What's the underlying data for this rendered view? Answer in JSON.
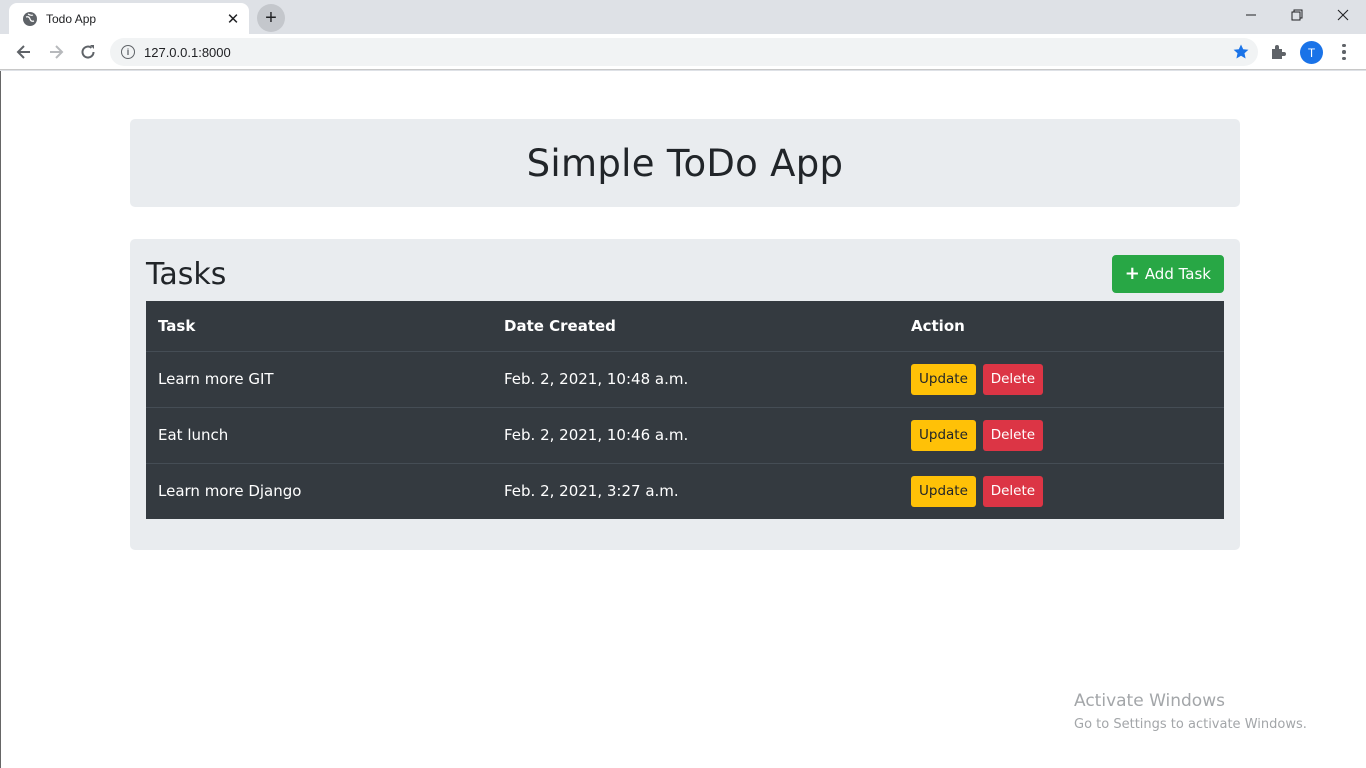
{
  "browser": {
    "tab_title": "Todo App",
    "tab_close": "✕",
    "new_tab": "+",
    "url": "127.0.0.1:8000",
    "profile_initial": "T",
    "accent": "#1a73e8"
  },
  "header": {
    "title": "Simple ToDo App"
  },
  "tasks_section": {
    "heading": "Tasks",
    "add_button": "Add Task",
    "add_icon": "+",
    "columns": [
      "Task",
      "Date Created",
      "Action"
    ],
    "rows": [
      {
        "task": "Learn more GIT",
        "date": "Feb. 2, 2021, 10:48 a.m.",
        "update": "Update",
        "delete": "Delete"
      },
      {
        "task": "Eat lunch",
        "date": "Feb. 2, 2021, 10:46 a.m.",
        "update": "Update",
        "delete": "Delete"
      },
      {
        "task": "Learn more Django",
        "date": "Feb. 2, 2021, 3:27 a.m.",
        "update": "Update",
        "delete": "Delete"
      }
    ]
  },
  "colors": {
    "success": "#28a745",
    "warning": "#ffc107",
    "danger": "#dc3545",
    "table_dark": "#343a40",
    "panel": "#e9ecef"
  },
  "watermark": {
    "title": "Activate Windows",
    "subtitle": "Go to Settings to activate Windows."
  }
}
